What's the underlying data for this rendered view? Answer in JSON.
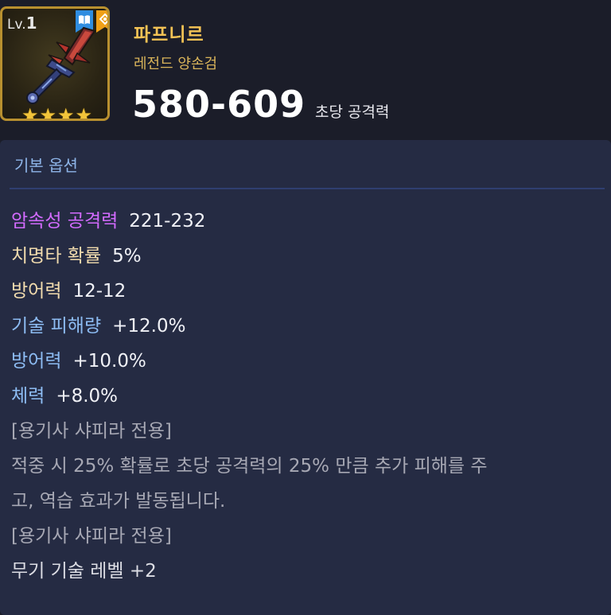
{
  "item": {
    "level_prefix": "Lv.",
    "level": "1",
    "stars": [
      "★",
      "★",
      "★",
      "★"
    ],
    "name": "파프니르",
    "type": "레전드 양손검",
    "attack_value": "580-609",
    "attack_label": "초당 공격력"
  },
  "options": {
    "section_title": "기본 옵션",
    "stats": [
      {
        "name": "암속성 공격력",
        "value": "221-232",
        "color": "#d36bff"
      },
      {
        "name": "치명타 확률",
        "value": "5%",
        "color": "#f2dcae"
      },
      {
        "name": "방어력",
        "value": "12-12",
        "color": "#f2dcae"
      },
      {
        "name": "기술 피해량",
        "value": "+12.0%",
        "color": "#8dbcf3"
      },
      {
        "name": "방어력",
        "value": "+10.0%",
        "color": "#8dbcf3"
      },
      {
        "name": "체력",
        "value": "+8.0%",
        "color": "#8dbcf3"
      }
    ],
    "lines": [
      "[용기사 샤피라 전용]",
      "적중 시 25% 확률로 초당 공격력의 25% 만큼 추가 피해를 주",
      "고, 역습 효과가 발동됩니다.",
      "[용기사 샤피라 전용]",
      "무기 기술 레벨 +2"
    ]
  },
  "colors": {
    "frame": "#b8902f",
    "name": "#f4c355",
    "panel": "#252b43",
    "header": "#1b1d29"
  },
  "icons": [
    "book-badge-icon",
    "rune-badge-icon",
    "greatsword-icon",
    "star-icon"
  ]
}
